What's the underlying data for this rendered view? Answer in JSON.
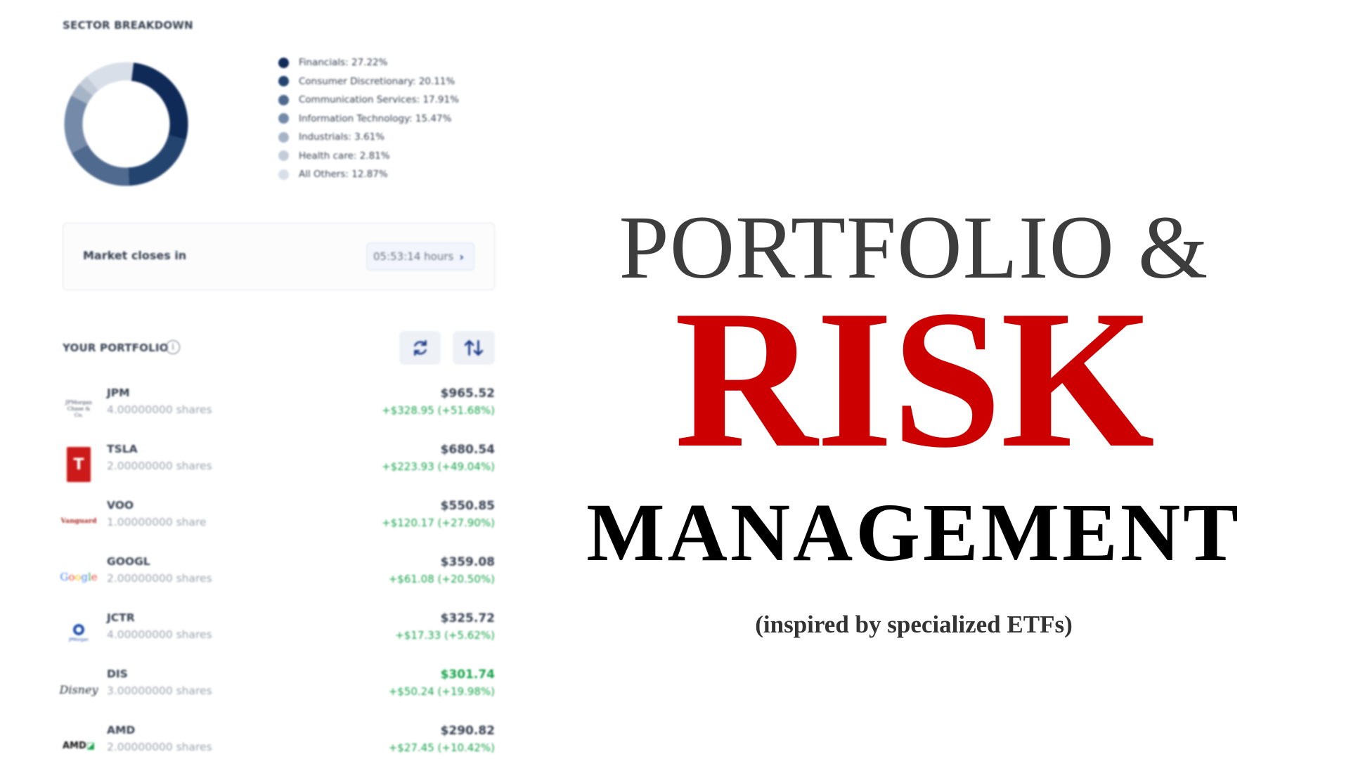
{
  "sector_breakdown": {
    "title": "SECTOR BREAKDOWN",
    "items": [
      {
        "label": "Financials: 27.22%",
        "value": 27.22,
        "color": "#0f2a57"
      },
      {
        "label": "Consumer Discretionary: 20.11%",
        "value": 20.11,
        "color": "#23446f"
      },
      {
        "label": "Communication Services: 17.91%",
        "value": 17.91,
        "color": "#4f6a8e"
      },
      {
        "label": "Information Technology: 15.47%",
        "value": 15.47,
        "color": "#748aa8"
      },
      {
        "label": "Industrials: 3.61%",
        "value": 3.61,
        "color": "#a6b4c7"
      },
      {
        "label": "Health care: 2.81%",
        "value": 2.81,
        "color": "#c3cdda"
      },
      {
        "label": "All Others: 12.87%",
        "value": 12.87,
        "color": "#d9dfe8"
      }
    ]
  },
  "market": {
    "label": "Market closes in",
    "countdown": "05:53:14 hours",
    "chevron": "›"
  },
  "portfolio": {
    "title": "YOUR PORTFOLIO",
    "info_glyph": "i",
    "holdings": [
      {
        "ticker": "JPM",
        "shares": "4.00000000 shares",
        "value": "$965.52",
        "change": "+$328.95 (+51.68%)",
        "logo_line1": "JPMorgan",
        "logo_line2": "Chase & Co."
      },
      {
        "ticker": "TSLA",
        "shares": "2.00000000 shares",
        "value": "$680.54",
        "change": "+$223.93 (+49.04%)",
        "logo_glyph": "T"
      },
      {
        "ticker": "VOO",
        "shares": "1.00000000 share",
        "value": "$550.85",
        "change": "+$120.17 (+27.90%)",
        "logo_text": "Vanguard"
      },
      {
        "ticker": "GOOGL",
        "shares": "2.00000000 shares",
        "value": "$359.08",
        "change": "+$61.08 (+20.50%)"
      },
      {
        "ticker": "JCTR",
        "shares": "4.00000000 shares",
        "value": "$325.72",
        "change": "+$17.33 (+5.62%)",
        "logo_text": "JPMorgan"
      },
      {
        "ticker": "DIS",
        "shares": "3.00000000 shares",
        "value": "$301.74",
        "change": "+$50.24 (+19.98%)",
        "logo_text": "Disney"
      },
      {
        "ticker": "AMD",
        "shares": "2.00000000 shares",
        "value": "$290.82",
        "change": "+$27.45 (+10.42%)",
        "logo_text": "AMD"
      }
    ]
  },
  "headline": {
    "line1": "PORTFOLIO &",
    "line2": "RISK",
    "line3": "MANAGEMENT",
    "line4": "(inspired by specialized ETFs)"
  },
  "colors": {
    "accent_red": "#cc0000",
    "gain_green": "#16a34a",
    "navy": "#0f2a57"
  }
}
